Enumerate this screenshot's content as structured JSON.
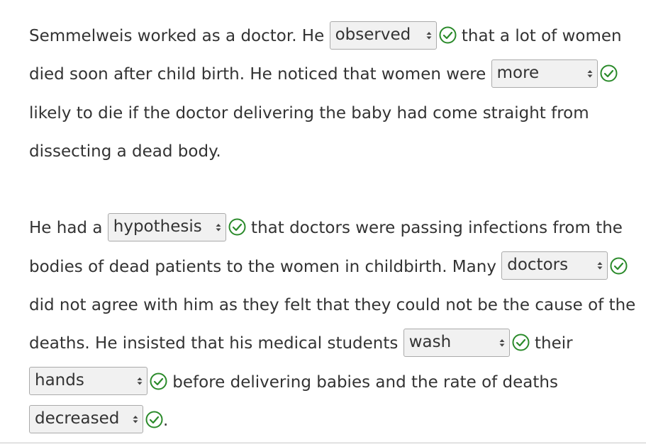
{
  "paragraph1": {
    "t1": "Semmelweis worked as a doctor. He ",
    "dd1": "observed",
    "t2": " that a lot of women died soon after child birth. He noticed that women were ",
    "dd2": "more",
    "t3": " likely to die if the doctor delivering the baby had come straight from dissecting a dead body."
  },
  "paragraph2": {
    "t1": "He had a ",
    "dd1": "hypothesis",
    "t2": " that doctors were passing infections from the bodies of dead patients to the women in childbirth. Many ",
    "dd2": "doctors",
    "t3": " did not agree with him as they felt that they could not be the cause of the deaths. He insisted that his medical students ",
    "dd3": "wash",
    "t4": " their ",
    "dd4": "hands",
    "t5": " before delivering babies and the rate of deaths ",
    "dd5": "decreased",
    "t6": "."
  },
  "icons": {
    "dropdown_arrows": "up-down-arrows",
    "correct": "check-circle-icon"
  },
  "colors": {
    "correct_green": "#2a8a2a",
    "text": "#333333",
    "dropdown_bg": "#f1f1f1"
  }
}
